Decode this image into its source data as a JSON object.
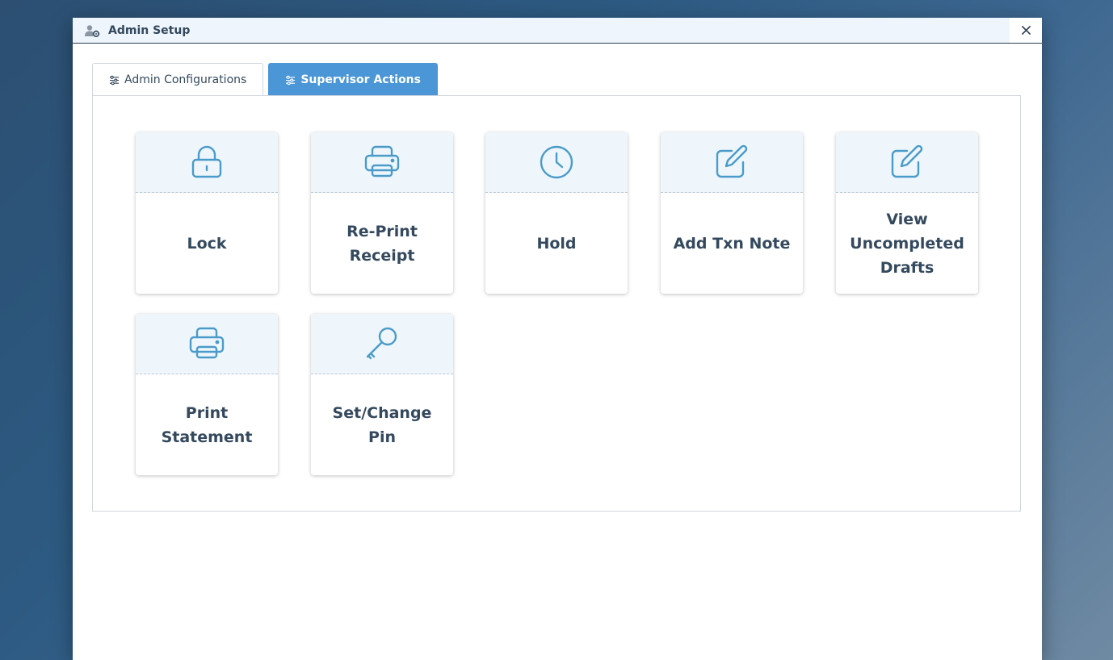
{
  "window": {
    "title": "Admin Setup",
    "title_icon": "user-gear-icon",
    "close_icon": "close-icon"
  },
  "tabs": [
    {
      "label": "Admin Configurations",
      "icon": "sliders-icon",
      "active": false
    },
    {
      "label": "Supervisor Actions",
      "icon": "sliders-icon",
      "active": true
    }
  ],
  "actions": [
    {
      "label": "Lock",
      "icon": "lock-icon"
    },
    {
      "label": "Re-Print Receipt",
      "icon": "printer-icon"
    },
    {
      "label": "Hold",
      "icon": "clock-icon"
    },
    {
      "label": "Add Txn Note",
      "icon": "edit-note-icon"
    },
    {
      "label": "View Uncompleted Drafts",
      "icon": "edit-note-icon"
    },
    {
      "label": "Print Statement",
      "icon": "printer-icon"
    },
    {
      "label": "Set/Change Pin",
      "icon": "key-icon"
    }
  ],
  "colors": {
    "accent": "#4a96d6",
    "icon": "#4a9bc9",
    "text": "#34495e"
  }
}
